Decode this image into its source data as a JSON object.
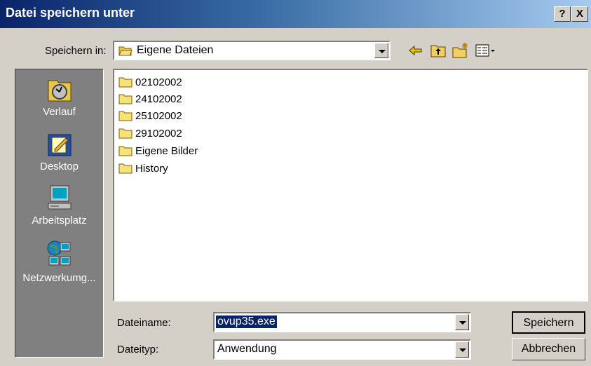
{
  "window": {
    "title": "Datei speichern unter",
    "help_label": "?",
    "close_label": "X"
  },
  "save_in": {
    "label": "Speichern in:",
    "value": "Eigene Dateien"
  },
  "places": [
    {
      "label": "Verlauf",
      "icon": "history-icon"
    },
    {
      "label": "Desktop",
      "icon": "desktop-icon"
    },
    {
      "label": "Arbeitsplatz",
      "icon": "my-computer-icon"
    },
    {
      "label": "Netzwerkumg...",
      "icon": "network-icon"
    }
  ],
  "files": [
    {
      "name": "02102002",
      "icon": "folder-icon"
    },
    {
      "name": "24102002",
      "icon": "folder-icon"
    },
    {
      "name": "25102002",
      "icon": "folder-icon"
    },
    {
      "name": "29102002",
      "icon": "folder-icon"
    },
    {
      "name": "Eigene Bilder",
      "icon": "folder-icon"
    },
    {
      "name": "History",
      "icon": "folder-icon"
    }
  ],
  "filename": {
    "label": "Dateiname:",
    "value": "ovup35.exe"
  },
  "filetype": {
    "label": "Dateityp:",
    "value": "Anwendung"
  },
  "buttons": {
    "save": "Speichern",
    "cancel": "Abbrechen"
  }
}
